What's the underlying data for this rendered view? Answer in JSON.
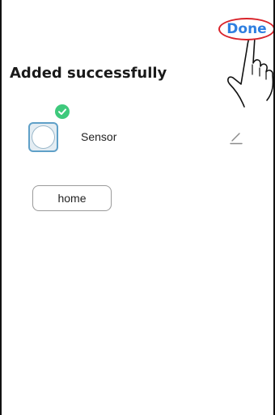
{
  "header": {
    "done_label": "Done",
    "done_color": "#2f7fe0",
    "highlight_color": "#d9232a"
  },
  "main": {
    "title": "Added successfully",
    "device": {
      "name": "Sensor",
      "icon": "sensor-icon",
      "status_icon": "check-circle-icon",
      "status_color": "#3ec97c",
      "edit_icon": "pencil-icon"
    },
    "room": {
      "label": "home"
    }
  }
}
